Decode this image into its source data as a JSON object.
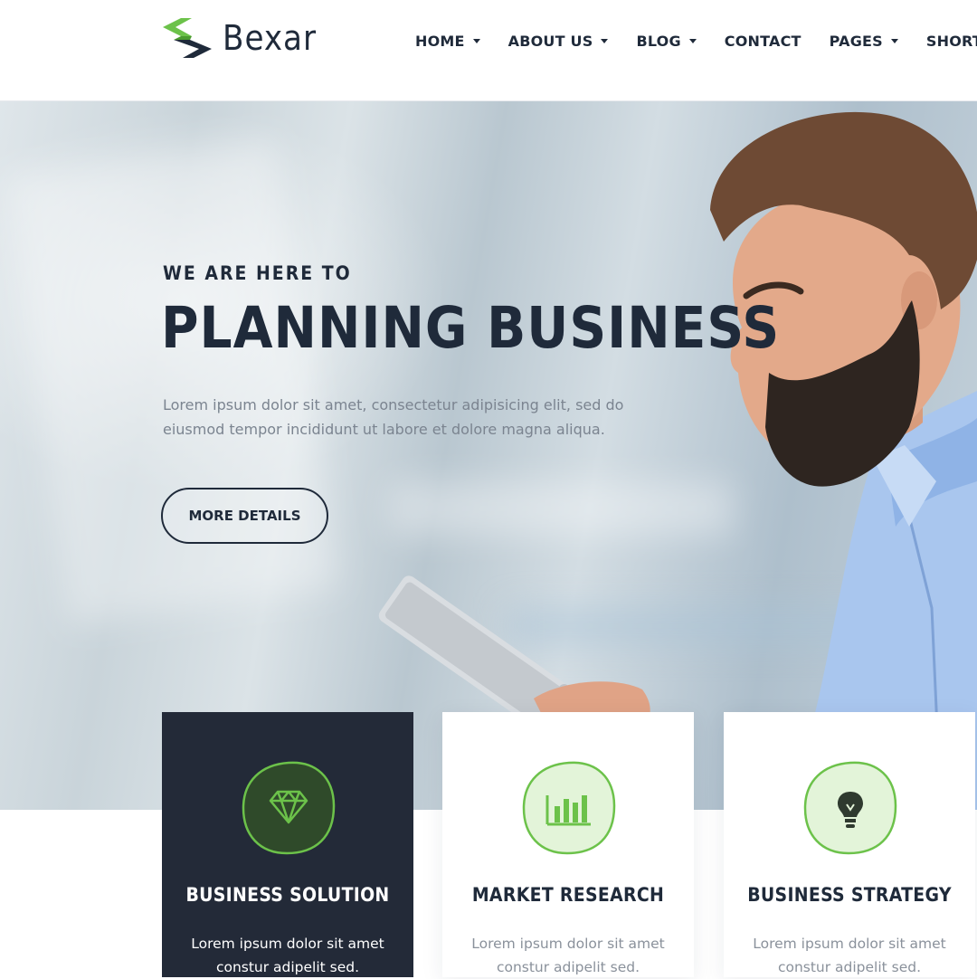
{
  "brand": {
    "name": "Bexar",
    "accent": "#6cc24a",
    "dark": "#1f2a3a"
  },
  "nav": [
    {
      "label": "HOME",
      "has_dropdown": true
    },
    {
      "label": "ABOUT US",
      "has_dropdown": true
    },
    {
      "label": "BLOG",
      "has_dropdown": true
    },
    {
      "label": "CONTACT",
      "has_dropdown": false
    },
    {
      "label": "PAGES",
      "has_dropdown": true
    },
    {
      "label": "SHORTCO",
      "has_dropdown": false
    }
  ],
  "hero": {
    "eyebrow": "WE ARE HERE TO",
    "headline": "PLANNING BUSINESS",
    "text": "Lorem ipsum dolor sit amet, consectetur adipisicing elit, sed do eiusmod tempor incididunt ut labore et dolore magna aliqua.",
    "button_label": "MORE DETAILS"
  },
  "cards": [
    {
      "title": "BUSINESS SOLUTION",
      "text": "Lorem ipsum dolor sit amet constur adipelit sed.",
      "icon": "diamond-icon",
      "active": true
    },
    {
      "title": "MARKET RESEARCH",
      "text": "Lorem ipsum dolor sit amet constur adipelit sed.",
      "icon": "bar-chart-icon",
      "active": false
    },
    {
      "title": "BUSINESS STRATEGY",
      "text": "Lorem ipsum dolor sit amet constur adipelit sed.",
      "icon": "lightbulb-icon",
      "active": false
    }
  ]
}
